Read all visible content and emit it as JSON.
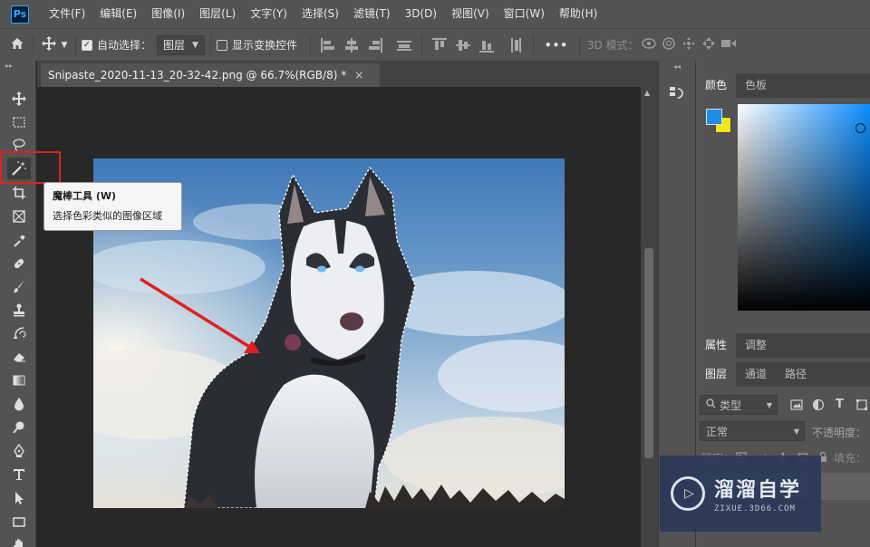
{
  "app": {
    "logo": "Ps"
  },
  "menu": [
    "文件(F)",
    "编辑(E)",
    "图像(I)",
    "图层(L)",
    "文字(Y)",
    "选择(S)",
    "滤镜(T)",
    "3D(D)",
    "视图(V)",
    "窗口(W)",
    "帮助(H)"
  ],
  "options": {
    "auto_select_label": "自动选择：",
    "auto_select_checked": true,
    "auto_select_value": "图层",
    "show_transform_label": "显示变换控件",
    "show_transform_checked": false,
    "more": "•••",
    "mode_3d_label": "3D 模式："
  },
  "document": {
    "tab_title": "Snipaste_2020-11-13_20-32-42.png @ 66.7%(RGB/8) *",
    "close": "×"
  },
  "toolbar": {
    "tools": [
      "move-tool",
      "marquee-tool",
      "lasso-tool",
      "magic-wand-tool",
      "crop-tool",
      "frame-tool",
      "eyedropper-tool",
      "healing-brush-tool",
      "brush-tool",
      "clone-stamp-tool",
      "history-brush-tool",
      "eraser-tool",
      "gradient-tool",
      "blur-tool",
      "dodge-tool",
      "pen-tool",
      "type-tool",
      "path-selection-tool",
      "rectangle-tool",
      "hand-tool"
    ],
    "active": "magic-wand-tool"
  },
  "tooltip": {
    "title": "魔棒工具 (W)",
    "description": "选择色彩类似的图像区域"
  },
  "panels": {
    "color_tabs": [
      "颜色",
      "色板"
    ],
    "foreground": "#1c8fe3",
    "background": "#f5e614",
    "props_tabs": [
      "属性",
      "调整"
    ],
    "layer_tabs": [
      "图层",
      "通道",
      "路径"
    ],
    "filter_kind": "类型",
    "blend_mode": "正常",
    "opacity_label": "不透明度：",
    "lock_label": "锁定：",
    "fill_label": "填充："
  },
  "watermark": {
    "title": "溜溜自学",
    "subtitle": "ZIXUE.3D66.COM"
  }
}
